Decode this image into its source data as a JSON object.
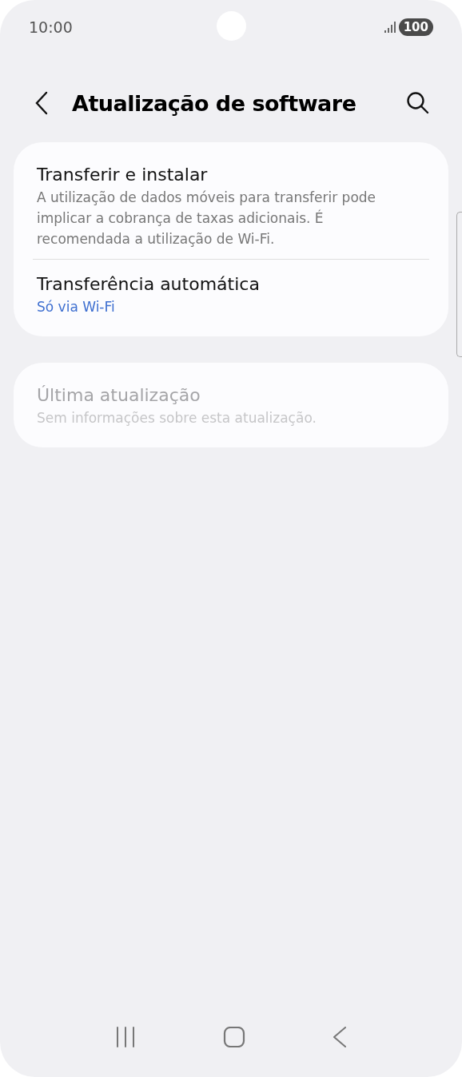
{
  "status_bar": {
    "time": "10:00",
    "battery": "100"
  },
  "header": {
    "title": "Atualização de software"
  },
  "cards": [
    {
      "items": [
        {
          "title": "Transferir e instalar",
          "subtitle": "A utilização de dados móveis para transferir pode implicar a cobrança de taxas adicionais. É recomendada a utilização de Wi-Fi.",
          "kind": "description",
          "disabled": false
        },
        {
          "title": "Transferência automática",
          "subtitle": "Só via Wi-Fi",
          "kind": "value",
          "disabled": false
        }
      ]
    },
    {
      "items": [
        {
          "title": "Última atualização",
          "subtitle": "Sem informações sobre esta atualização.",
          "kind": "description",
          "disabled": true
        }
      ]
    }
  ]
}
